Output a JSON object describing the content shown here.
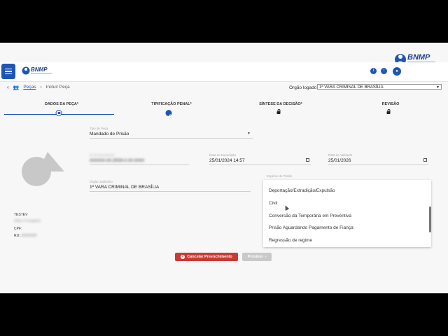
{
  "header": {
    "logo_text": "BNMP",
    "big_logo_text": "BNMP",
    "user_name": "..."
  },
  "breadcrumb": {
    "items": [
      "Peças",
      "Incluir Peça"
    ]
  },
  "orgao": {
    "label": "Órgão logado:",
    "value": "1ª VARA CRIMINAL DE BRASÍLIA"
  },
  "steps": [
    {
      "label": "DADOS DA PEÇA*",
      "state": "current"
    },
    {
      "label": "TIPIFICAÇÃO PENAL*",
      "state": "done"
    },
    {
      "label": "SÍNTESE DA DECISÃO*",
      "state": "locked"
    },
    {
      "label": "REVISÃO",
      "state": "locked"
    }
  ],
  "fields": {
    "tipo_label": "Tipo de Peça",
    "tipo_value": "Mandado de Prisão",
    "numero_label": "Nº do Documento",
    "numero_value": "######-##.2024.#.##.####",
    "data_expedicao_label": "Data de Expedição",
    "data_expedicao_value": "25/01/2024 14:57",
    "data_validade_label": "Data de Validade",
    "data_validade_value": "25/01/2026",
    "orgao_judiciario_label": "Órgão Judiciário",
    "orgao_judiciario_value": "1ª VARA CRIMINAL DE BRASÍLIA",
    "especie_label": "Espécie de Prisão"
  },
  "person": {
    "name": "TESTEV",
    "status": "(Não é Foragido)",
    "cpf_label": "CPF:",
    "rji_label": "RJI:",
    "rji_value": "########"
  },
  "dropdown": {
    "options": [
      "Deportação/Extradição/Expulsão",
      "Civil",
      "Conversão da Temporária em Preventiva",
      "Prisão Aguardando Pagamento de Fiança",
      "Regressão de regime"
    ]
  },
  "buttons": {
    "cancel": "Cancelar Preenchimento",
    "next": "Próximo"
  },
  "colors": {
    "primary": "#1f56b5",
    "danger": "#c93a35"
  }
}
